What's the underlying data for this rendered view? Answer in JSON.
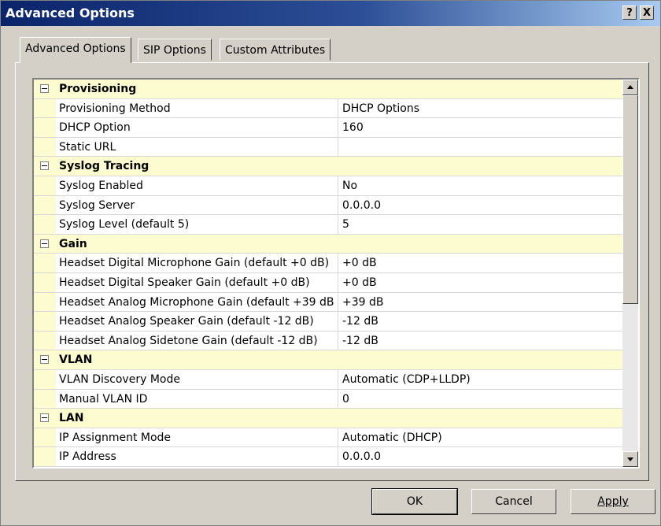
{
  "window": {
    "title": "Advanced Options"
  },
  "titlebar": {
    "help_label": "?",
    "close_label": "X"
  },
  "tabs": [
    {
      "label": "Advanced Options",
      "active": true
    },
    {
      "label": "SIP Options",
      "active": false
    },
    {
      "label": "Custom Attributes",
      "active": false
    }
  ],
  "grid": {
    "rows": [
      {
        "type": "category",
        "name": "Provisioning"
      },
      {
        "type": "property",
        "name": "Provisioning Method",
        "value": "DHCP Options"
      },
      {
        "type": "property",
        "name": "DHCP Option",
        "value": "160"
      },
      {
        "type": "property",
        "name": "Static URL",
        "value": ""
      },
      {
        "type": "category",
        "name": "Syslog Tracing"
      },
      {
        "type": "property",
        "name": "Syslog Enabled",
        "value": "No"
      },
      {
        "type": "property",
        "name": "Syslog Server",
        "value": "0.0.0.0"
      },
      {
        "type": "property",
        "name": "Syslog Level (default 5)",
        "value": "5"
      },
      {
        "type": "category",
        "name": "Gain"
      },
      {
        "type": "property",
        "name": "Headset Digital Microphone Gain (default +0 dB)",
        "value": "+0 dB"
      },
      {
        "type": "property",
        "name": "Headset Digital Speaker Gain (default +0 dB)",
        "value": "+0 dB"
      },
      {
        "type": "property",
        "name": "Headset Analog Microphone Gain (default +39 dB)",
        "value": "+39 dB"
      },
      {
        "type": "property",
        "name": "Headset Analog Speaker Gain (default -12 dB)",
        "value": "-12 dB"
      },
      {
        "type": "property",
        "name": "Headset Analog Sidetone Gain (default -12 dB)",
        "value": "-12 dB"
      },
      {
        "type": "category",
        "name": "VLAN"
      },
      {
        "type": "property",
        "name": "VLAN Discovery Mode",
        "value": "Automatic (CDP+LLDP)"
      },
      {
        "type": "property",
        "name": "Manual VLAN ID",
        "value": "0"
      },
      {
        "type": "category",
        "name": "LAN"
      },
      {
        "type": "property",
        "name": "IP Assignment Mode",
        "value": "Automatic (DHCP)"
      },
      {
        "type": "property",
        "name": "IP Address",
        "value": "0.0.0.0"
      }
    ]
  },
  "buttons": {
    "ok_label": "OK",
    "cancel_label": "Cancel",
    "apply_label": "Apply"
  }
}
